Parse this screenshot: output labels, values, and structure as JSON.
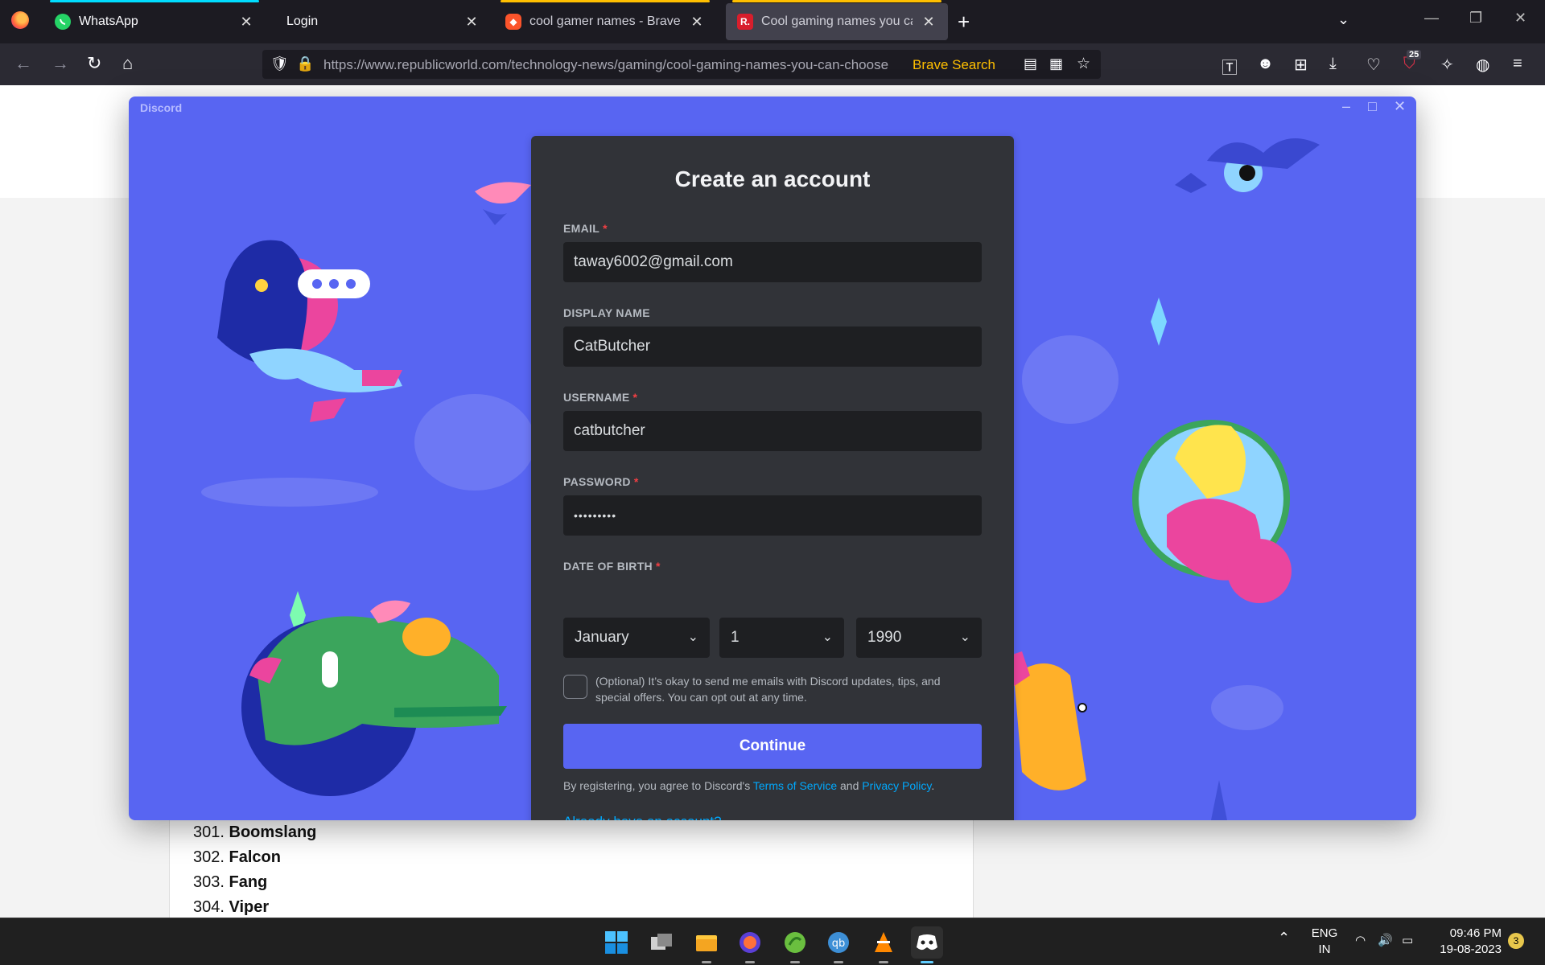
{
  "browser": {
    "tabs": [
      {
        "title": "WhatsApp",
        "close": "✕"
      },
      {
        "title": "Login",
        "close": "✕"
      },
      {
        "title": "cool gamer names - Brave Search",
        "close": "✕"
      },
      {
        "title": "Cool gaming names you can choose",
        "close": "✕"
      }
    ],
    "url_host": "https://www.republicworld.com",
    "url_path": "/technology-news/gaming/cool-gaming-names-you-can-choose",
    "search_engine": "Brave Search",
    "extension_badge": "25"
  },
  "page": {
    "names": [
      {
        "num": "301.",
        "name": "Boomslang"
      },
      {
        "num": "302.",
        "name": "Falcon"
      },
      {
        "num": "303.",
        "name": "Fang"
      },
      {
        "num": "304.",
        "name": "Viper"
      }
    ]
  },
  "discord": {
    "window_title": "Discord",
    "heading": "Create an account",
    "email_label": "EMAIL",
    "email_value": "taway6002@gmail.com",
    "display_name_label": "DISPLAY NAME",
    "display_name_value": "CatButcher",
    "username_label": "USERNAME",
    "username_value": "catbutcher",
    "password_label": "PASSWORD",
    "password_value": "•••••••••",
    "dob_label": "DATE OF BIRTH",
    "dob_month": "January",
    "dob_day": "1",
    "dob_year": "1990",
    "required_mark": "*",
    "optin_text": "(Optional) It’s okay to send me emails with Discord updates, tips, and special offers. You can opt out at any time.",
    "continue_label": "Continue",
    "legal_prefix": "By registering, you agree to Discord's",
    "terms_label": "Terms of Service",
    "legal_and": "and",
    "privacy_label": "Privacy Policy",
    "legal_suffix": ".",
    "login_link": "Already have an account?",
    "accent": "#5865f2"
  },
  "taskbar": {
    "lang_top": "ENG",
    "lang_bottom": "IN",
    "time": "09:46 PM",
    "date": "19-08-2023",
    "notifications": "3"
  }
}
